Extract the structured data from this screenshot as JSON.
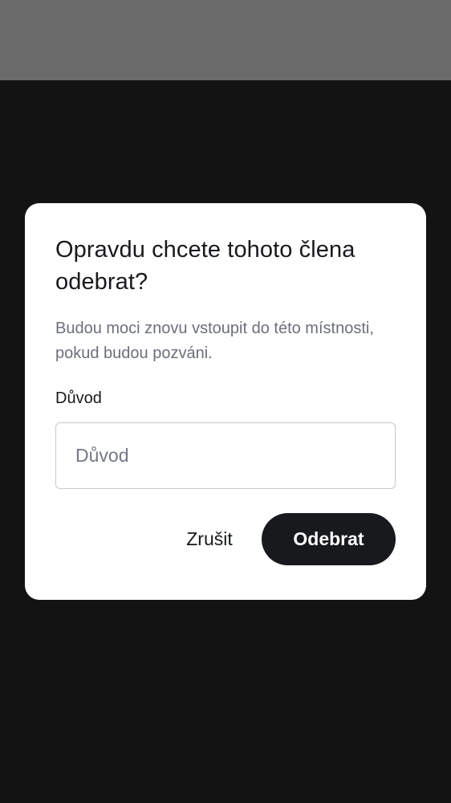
{
  "colors": {
    "status_bar": "#6b6b6b",
    "backdrop": "#131313",
    "dialog_background": "#ffffff",
    "primary_text": "#17191c",
    "secondary_text": "#6a6f7a",
    "input_border": "#c6c8cc",
    "primary_button": "#17191c",
    "primary_button_text": "#ffffff"
  },
  "dialog": {
    "title": "Opravdu chcete tohoto člena odebrat?",
    "description": "Budou moci znovu vstoupit do této místnosti, pokud budou pozváni.",
    "reason_label": "Důvod",
    "reason_value": "",
    "reason_placeholder": "Důvod",
    "cancel_label": "Zrušit",
    "confirm_label": "Odebrat"
  }
}
